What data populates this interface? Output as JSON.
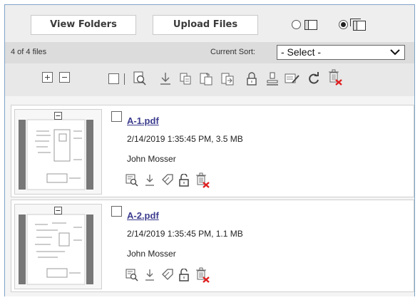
{
  "header": {
    "view_folders_label": "View Folders",
    "upload_files_label": "Upload Files",
    "view_mode_selected": "thumbnail"
  },
  "status": {
    "file_count": "4 of 4 files",
    "sort_label": "Current Sort:",
    "sort_value": "- Select -"
  },
  "toolbar": {
    "icons": [
      "expand-icon",
      "collapse-icon",
      "select-all-checkbox",
      "search-document-icon",
      "download-icon",
      "copy-icon",
      "move-icon",
      "import-icon",
      "lock-icon",
      "stamp-icon",
      "edit-icon",
      "refresh-icon",
      "delete-icon"
    ]
  },
  "files": [
    {
      "name": "A-1.pdf",
      "date_size": "2/14/2019 1:35:45 PM, 3.5 MB",
      "owner": "John Mosser",
      "actions": [
        "view-icon",
        "download-icon",
        "tag-icon",
        "unlock-icon",
        "delete-icon"
      ]
    },
    {
      "name": "A-2.pdf",
      "date_size": "2/14/2019 1:35:45 PM, 1.1 MB",
      "owner": "John Mosser",
      "actions": [
        "view-icon",
        "download-icon",
        "tag-icon",
        "unlock-icon",
        "delete-icon"
      ]
    }
  ],
  "colors": {
    "link": "#3b3b8e",
    "delete_x": "#e02020",
    "frame_border": "#7fa3c8"
  }
}
